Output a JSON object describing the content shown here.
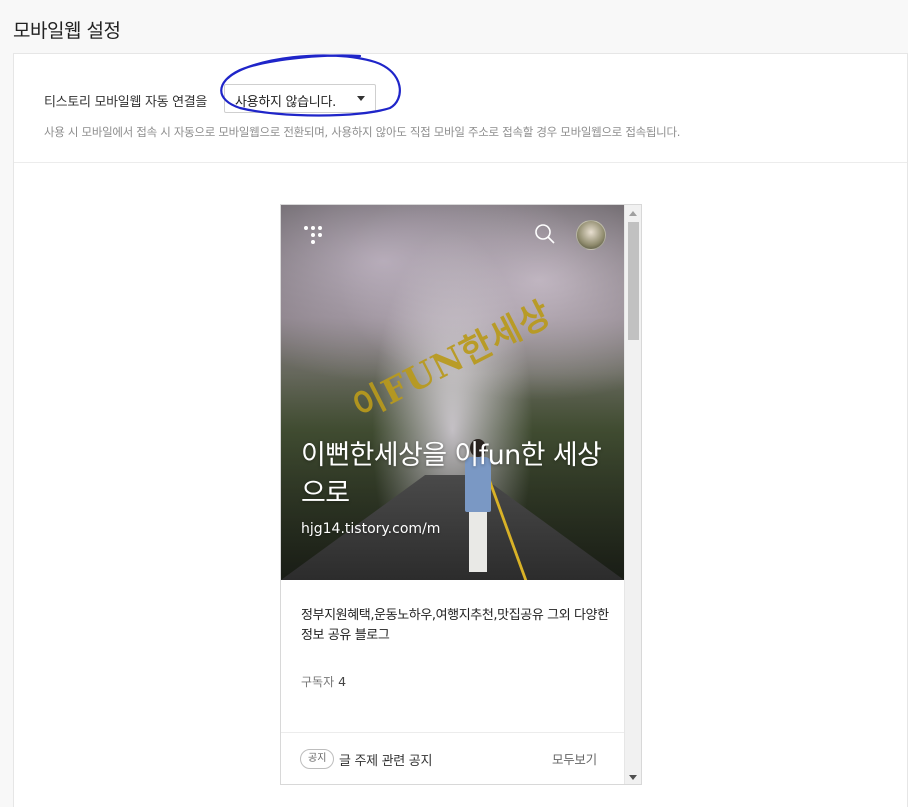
{
  "page": {
    "title": "모바일웹 설정"
  },
  "setting": {
    "label": "티스토리 모바일웹 자동 연결을",
    "select_value": "사용하지 않습니다.",
    "helper": "사용 시 모바일에서 접속 시 자동으로 모바일웹으로 전환되며, 사용하지 않아도 직접 모바일 주소로 접속할 경우 모바일웹으로 접속됩니다."
  },
  "annotation": {
    "color": "#1f25c9"
  },
  "preview": {
    "watermark": "이FUN한세상",
    "blog_title": "이뻔한세상을 이fun한 세상으로",
    "blog_url": "hjg14.tistory.com/m",
    "description": "정부지원혜택,운동노하우,여행지추천,맛집공유 그외 다양한 정보 공유 블로그",
    "subscriber_label": "구독자",
    "subscriber_count": "4",
    "notice_badge": "공지",
    "notice_title": "글 주제 관련 공지",
    "view_all": "모두보기",
    "icons": {
      "menu": "menu-dots-icon",
      "search": "search-icon"
    }
  }
}
